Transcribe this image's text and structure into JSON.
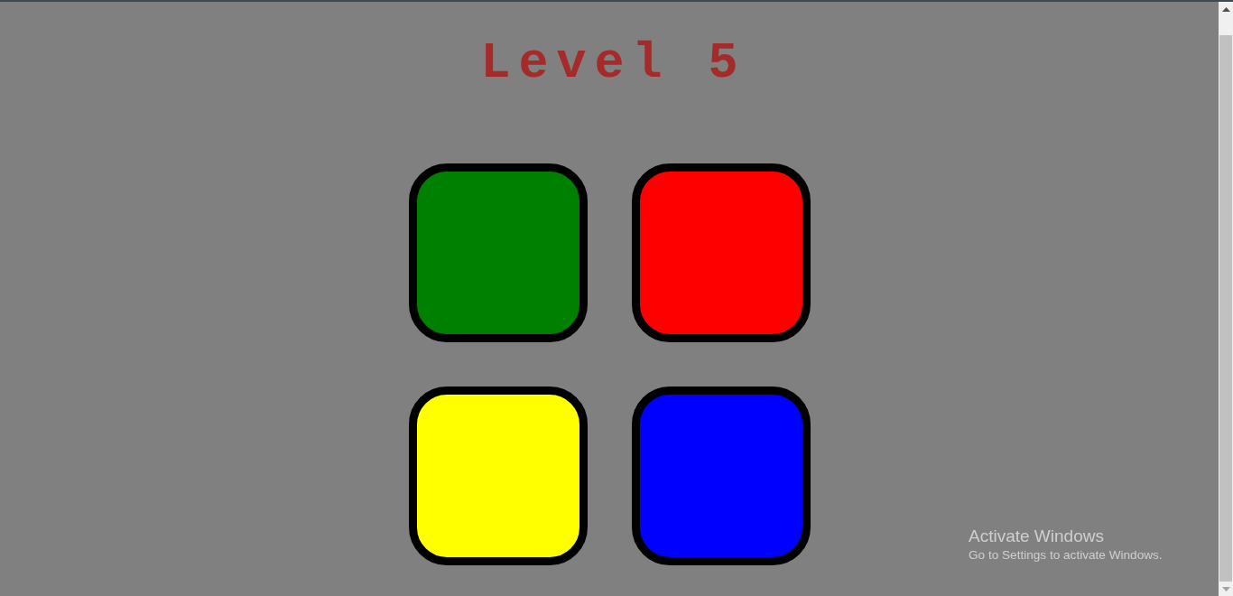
{
  "title": "Level 5",
  "pads": [
    {
      "color": "#008000"
    },
    {
      "color": "#ff0000"
    },
    {
      "color": "#ffff00"
    },
    {
      "color": "#0000ff"
    }
  ],
  "activation_notice": {
    "title": "Activate Windows",
    "message": "Go to Settings to activate Windows."
  }
}
